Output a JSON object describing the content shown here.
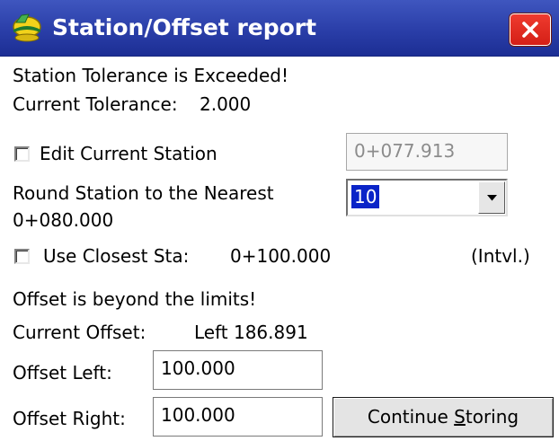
{
  "window": {
    "title": "Station/Offset report",
    "close_label": "×"
  },
  "station": {
    "tolerance_message": "Station Tolerance is Exceeded!",
    "current_tolerance_label": "Current Tolerance:",
    "current_tolerance_value": "2.000",
    "edit_current_station_label": "Edit Current Station",
    "edit_current_station_checked": false,
    "current_station_value": "0+077.913",
    "round_label": "Round Station to the Nearest",
    "rounded_station": "0+080.000",
    "round_interval": "10",
    "use_closest_label": "Use Closest Sta:",
    "use_closest_checked": false,
    "closest_station_value": "0+100.000",
    "interval_note": "(Intvl.)"
  },
  "offset": {
    "limits_message": "Offset is beyond the limits!",
    "current_offset_label": "Current Offset:",
    "current_offset_value": "Left 186.891",
    "offset_left_label": "Offset Left:",
    "offset_left_value": "100.000",
    "offset_right_label": "Offset Right:",
    "offset_right_value": "100.000"
  },
  "actions": {
    "continue_prefix": "Continue ",
    "continue_underlined": "S",
    "continue_suffix": "toring"
  },
  "colors": {
    "titlebar": "#2a3ea8",
    "close_button": "#d41f16",
    "selection": "#0a24c8"
  }
}
